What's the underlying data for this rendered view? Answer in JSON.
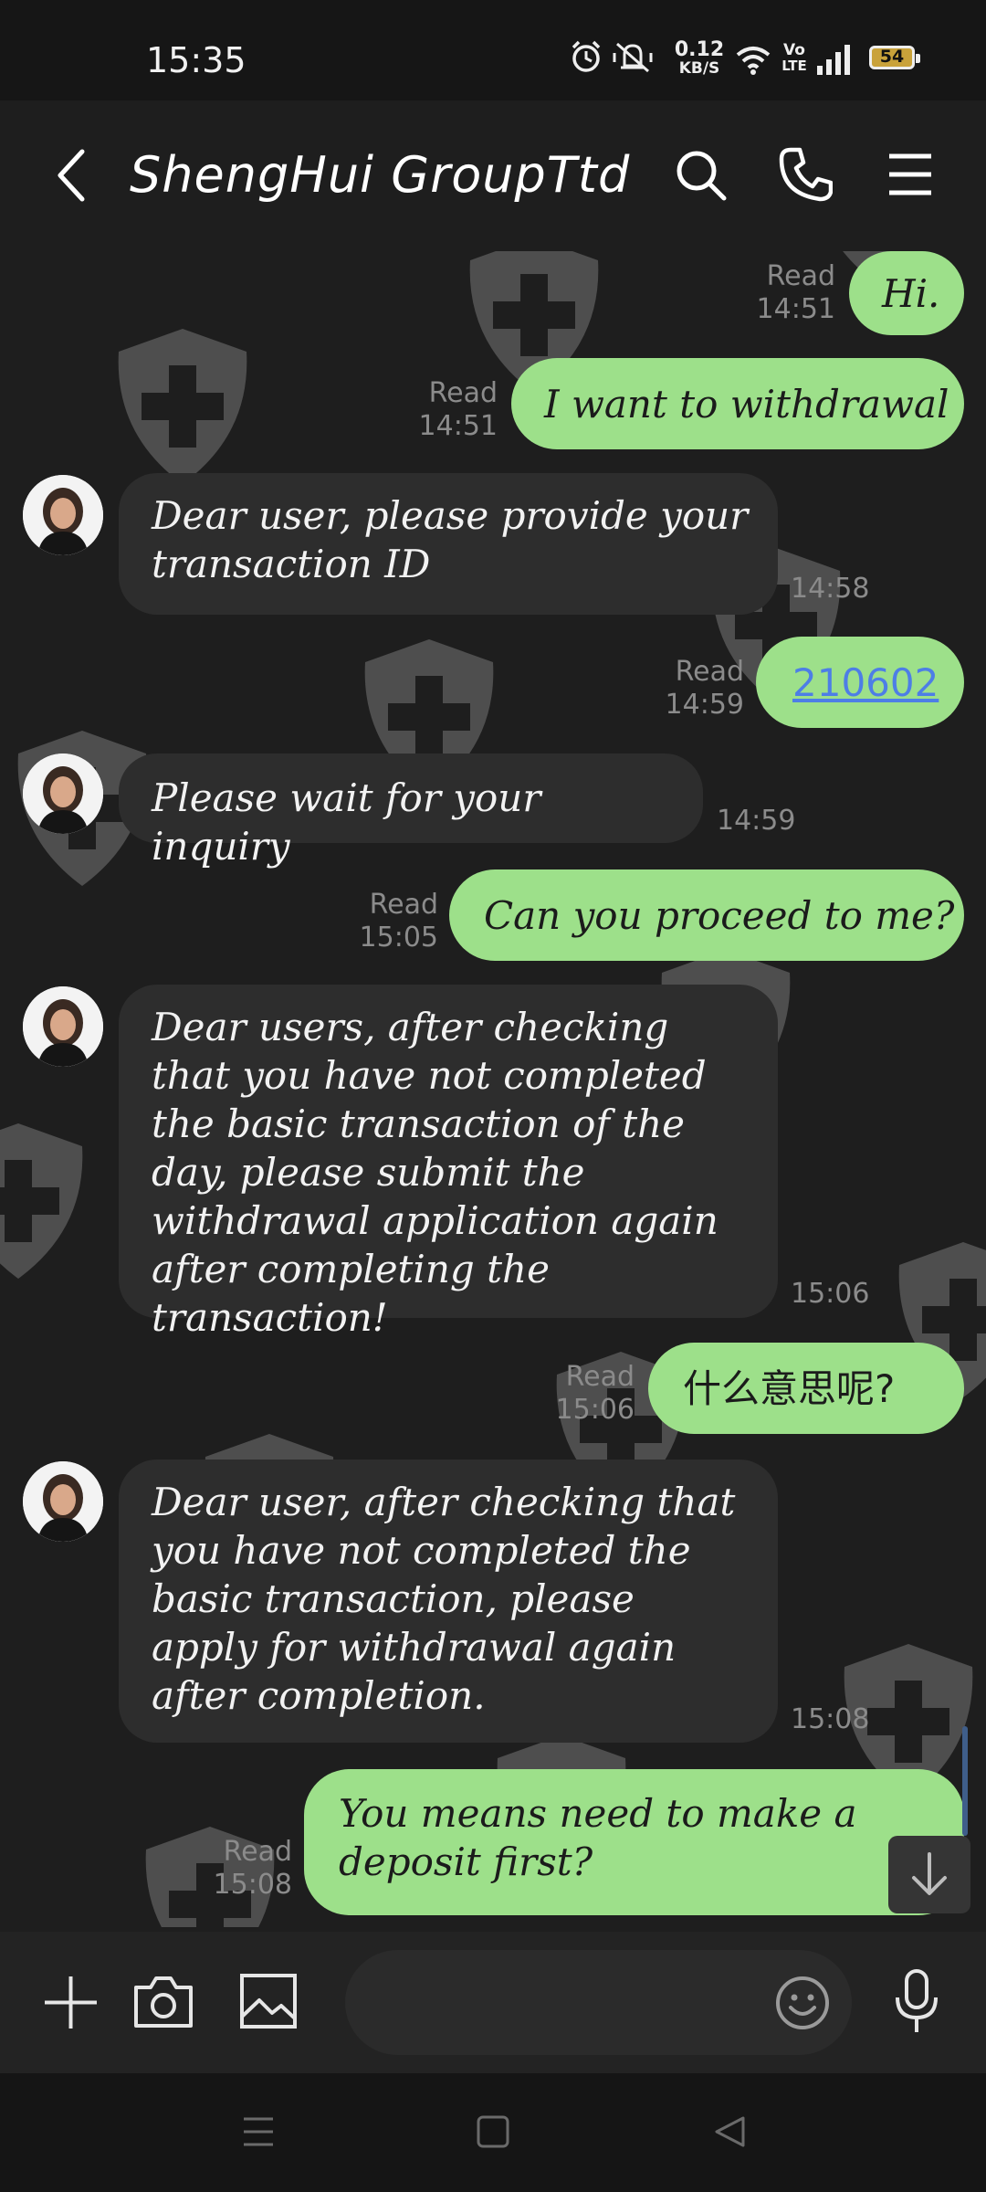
{
  "status_bar": {
    "time": "15:35",
    "net_speed_value": "0.12",
    "net_speed_unit": "KB/S",
    "volte_top": "Vo",
    "volte_bottom": "LTE",
    "battery": "54",
    "icons": [
      "alarm-icon",
      "mute-vibrate-icon",
      "wifi-icon",
      "volte-icon",
      "signal-icon",
      "battery-icon"
    ]
  },
  "header": {
    "title": "ShengHui GroupTtd",
    "icons": [
      "back-arrow-icon",
      "search-icon",
      "phone-icon",
      "menu-icon"
    ]
  },
  "messages": [
    {
      "dir": "out",
      "text": "Hi.",
      "status": "Read",
      "time": "14:51"
    },
    {
      "dir": "out",
      "text": "I want to withdrawal",
      "status": "Read",
      "time": "14:51"
    },
    {
      "dir": "in",
      "text": "Dear user, please provide your transaction ID",
      "time": "14:58"
    },
    {
      "dir": "out",
      "text": "210602",
      "status": "Read",
      "time": "14:59"
    },
    {
      "dir": "in",
      "text": "Please wait for your inquiry",
      "time": "14:59"
    },
    {
      "dir": "out",
      "text": "Can you proceed to me?",
      "status": "Read",
      "time": "15:05"
    },
    {
      "dir": "in",
      "text": "Dear users, after checking that you have not completed the basic transaction of the day, please submit the withdrawal application again after completing the transaction!",
      "time": "15:06"
    },
    {
      "dir": "out",
      "text": "什么意思呢?",
      "status": "Read",
      "time": "15:06"
    },
    {
      "dir": "in",
      "text": "Dear user, after checking that you have not completed the basic transaction, please apply for withdrawal again after completion.",
      "time": "15:08"
    },
    {
      "dir": "out",
      "text": "You means need to make a deposit first?",
      "status": "Read",
      "time": "15:08"
    }
  ],
  "input_bar": {
    "icons": [
      "plus-icon",
      "camera-icon",
      "gallery-icon",
      "emoji-icon",
      "microphone-icon"
    ]
  },
  "nav_bar": {
    "icons": [
      "recent-apps-icon",
      "home-icon",
      "back-icon"
    ]
  },
  "colors": {
    "outgoing_bubble": "#9de08a",
    "incoming_bubble": "#2d2d2d",
    "background": "#1e1e1e",
    "link": "#4d7ee6"
  }
}
